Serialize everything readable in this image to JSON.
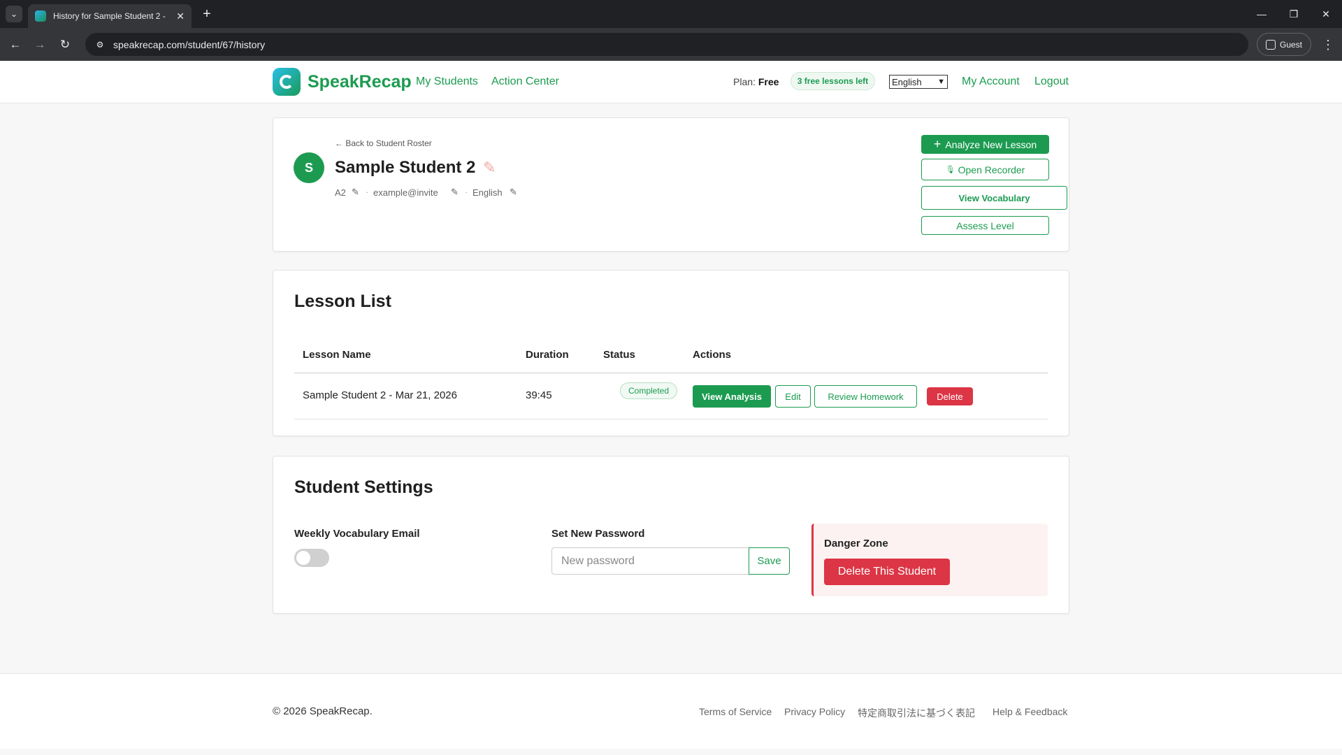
{
  "browser": {
    "tab_title": "History for Sample Student 2 - ",
    "url": "speakrecap.com/student/67/history",
    "guest_label": "Guest"
  },
  "header": {
    "brand": "SpeakRecap",
    "nav": [
      "My Students",
      "Action Center"
    ],
    "plan_label": "Plan:",
    "plan_value": "Free",
    "lessons_left": "3 free lessons left",
    "language": "English",
    "my_account": "My Account",
    "logout": "Logout"
  },
  "student": {
    "back_link": "← Back to Student Roster",
    "avatar_letter": "S",
    "name": "Sample Student 2",
    "level": "A2",
    "email": "example@invite",
    "language": "English",
    "actions": {
      "analyze": "Analyze New Lesson",
      "recorder": "Open Recorder",
      "vocabulary": "View Vocabulary",
      "assess": "Assess Level"
    }
  },
  "lessons": {
    "heading": "Lesson List",
    "columns": [
      "Lesson Name",
      "Duration",
      "Status",
      "Actions"
    ],
    "rows": [
      {
        "name": "Sample Student 2 - Mar 21, 2026",
        "duration": "39:45",
        "status": "Completed",
        "view": "View Analysis",
        "edit": "Edit",
        "review": "Review Homework",
        "delete": "Delete"
      }
    ]
  },
  "settings": {
    "heading": "Student Settings",
    "weekly_email_label": "Weekly Vocabulary Email",
    "weekly_email_on": false,
    "password_label": "Set New Password",
    "password_placeholder": "New password",
    "save": "Save",
    "danger_title": "Danger Zone",
    "delete_student": "Delete This Student"
  },
  "footer": {
    "copyright": "© 2026 SpeakRecap.",
    "links": [
      "Terms of Service",
      "Privacy Policy",
      "特定商取引法に基づく表記",
      "Help & Feedback"
    ]
  },
  "colors": {
    "brand_green": "#1c9b50",
    "danger_red": "#dc3545"
  }
}
